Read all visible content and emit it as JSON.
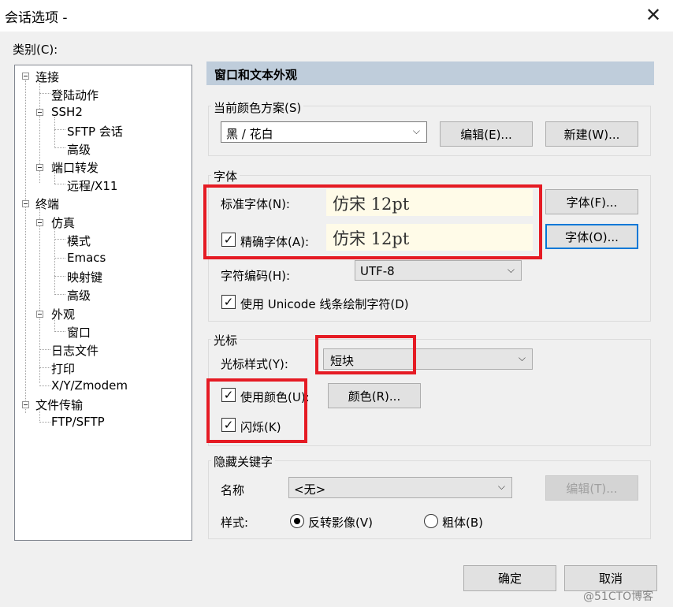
{
  "window": {
    "title": "会话选项 -"
  },
  "category": {
    "label": "类别(C):"
  },
  "tree": [
    {
      "label": "连接"
    },
    {
      "label": "登陆动作"
    },
    {
      "label": "SSH2"
    },
    {
      "label": "SFTP 会话"
    },
    {
      "label": "高级"
    },
    {
      "label": "端口转发"
    },
    {
      "label": "远程/X11"
    },
    {
      "label": "终端"
    },
    {
      "label": "仿真"
    },
    {
      "label": "模式"
    },
    {
      "label": "Emacs"
    },
    {
      "label": "映射键"
    },
    {
      "label": "高级"
    },
    {
      "label": "外观"
    },
    {
      "label": "窗口"
    },
    {
      "label": "日志文件"
    },
    {
      "label": "打印"
    },
    {
      "label": "X/Y/Zmodem"
    },
    {
      "label": "文件传输"
    },
    {
      "label": "FTP/SFTP"
    }
  ],
  "panel": {
    "title": "窗口和文本外观"
  },
  "scheme": {
    "label": "当前颜色方案(S)",
    "value": "黑 / 花白",
    "edit": "编辑(E)...",
    "new": "新建(W)..."
  },
  "font": {
    "group": "字体",
    "normal_label": "标准字体(N):",
    "normal_value": "仿宋 12pt",
    "normal_btn": "字体(F)...",
    "precise_label": "精确字体(A):",
    "precise_value": "仿宋 12pt",
    "precise_btn": "字体(O)...",
    "encoding_label": "字符编码(H):",
    "encoding_value": "UTF-8",
    "unicode_label": "使用 Unicode 线条绘制字符(D)"
  },
  "cursor": {
    "group": "光标",
    "style_label": "光标样式(Y):",
    "style_value": "短块",
    "use_color": "使用颜色(U):",
    "color_btn": "颜色(R)...",
    "blink": "闪烁(K)"
  },
  "keyword": {
    "group": "隐藏关键字",
    "name_label": "名称",
    "name_value": "<无>",
    "edit_btn": "编辑(T)...",
    "style_label": "样式:",
    "reverse": "反转影像(V)",
    "bold": "粗体(B)"
  },
  "footer": {
    "ok": "确定",
    "cancel": "取消"
  },
  "watermark": "@51CTO博客",
  "glyphs": {
    "close": "✕",
    "chevron": "⌵",
    "check": "✓"
  },
  "colors": {
    "highlight": "#e51b24",
    "header": "#bfcddb",
    "focus": "#0078d7"
  }
}
